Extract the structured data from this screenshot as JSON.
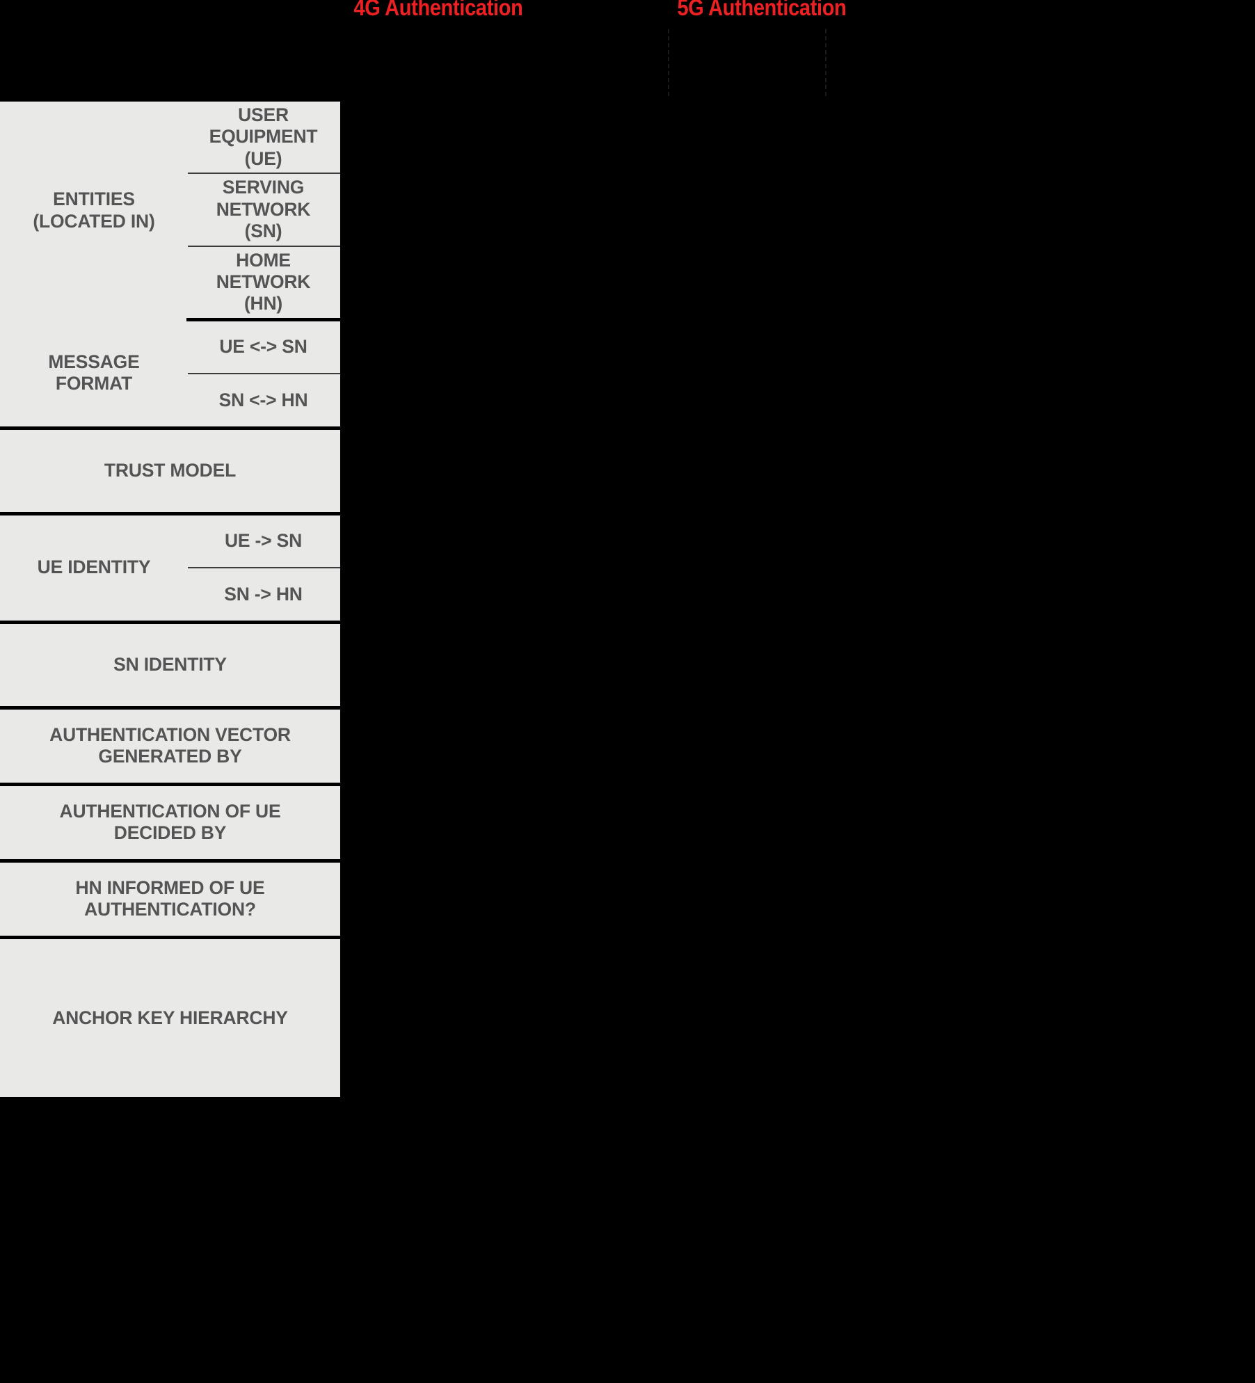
{
  "background_color": "#000000",
  "accent_color": "#ed2024",
  "table_cell_bg": "#e9e9e8",
  "table_text_color": "#545454",
  "headers": {
    "col_4g": "4G Authentication",
    "col_5g": "5G Authentication"
  },
  "attribute_table": {
    "rows": [
      {
        "label": "ENTITIES\n(LOCATED IN)",
        "label_line1": "ENTITIES",
        "label_line2": "(LOCATED IN)",
        "subrows": [
          {
            "line1": "USER EQUIPMENT",
            "line2": "(UE)"
          },
          {
            "line1": "SERVING",
            "line2": "NETWORK",
            "line3": "(SN)"
          },
          {
            "line1": "HOME NETWORK",
            "line2": "(HN)"
          }
        ]
      },
      {
        "label_line1": "MESSAGE",
        "label_line2": "FORMAT",
        "subrows": [
          {
            "line1": "UE <-> SN"
          },
          {
            "line1": "SN <-> HN"
          }
        ]
      },
      {
        "full_label": "TRUST MODEL",
        "subrows": []
      },
      {
        "label_line1": "UE IDENTITY",
        "subrows": [
          {
            "line1": "UE -> SN"
          },
          {
            "line1": "SN -> HN"
          }
        ]
      },
      {
        "full_label": "SN IDENTITY",
        "subrows": []
      },
      {
        "full_label_line1": "AUTHENTICATION VECTOR",
        "full_label_line2": "GENERATED BY",
        "subrows": []
      },
      {
        "full_label_line1": "AUTHENTICATION OF UE",
        "full_label_line2": "DECIDED BY",
        "subrows": []
      },
      {
        "full_label_line1": "HN INFORMED OF UE",
        "full_label_line2": "AUTHENTICATION?",
        "subrows": []
      },
      {
        "full_label": "ANCHOR KEY HIERARCHY",
        "subrows": []
      }
    ]
  }
}
